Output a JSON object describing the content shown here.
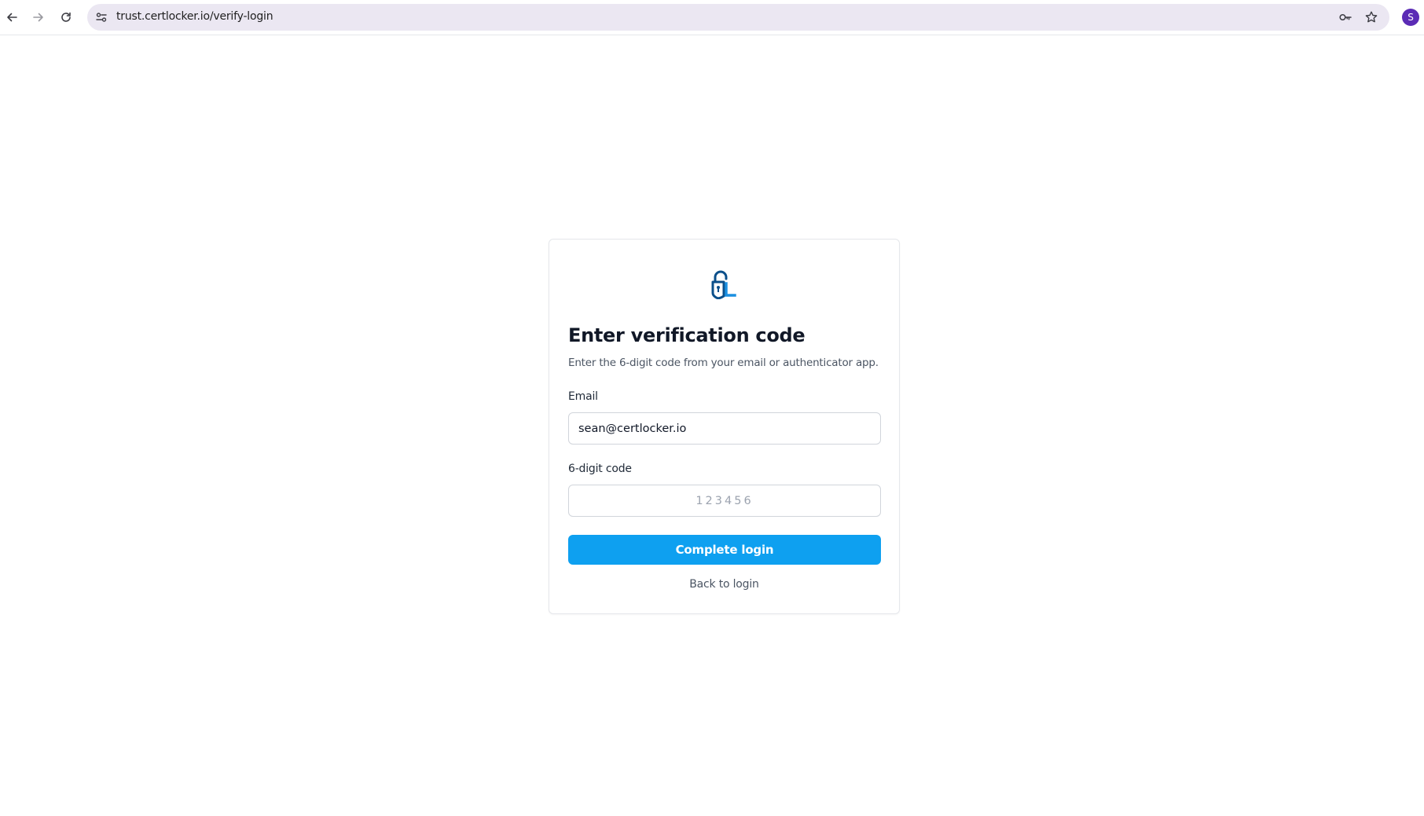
{
  "browser": {
    "url": "trust.certlocker.io/verify-login",
    "avatar_initial": "S",
    "avatar_color": "#5b2bb5"
  },
  "verify": {
    "title": "Enter verification code",
    "subtitle": "Enter the 6-digit code from your email or authenticator app.",
    "email_label": "Email",
    "email_value": "sean@certlocker.io",
    "code_label": "6-digit code",
    "code_value": "",
    "code_placeholder": "123456",
    "submit_label": "Complete login",
    "back_label": "Back to login"
  },
  "colors": {
    "primary": "#0ea0f0",
    "logo_dark": "#0b4f8a",
    "logo_light": "#1b8fe0"
  }
}
